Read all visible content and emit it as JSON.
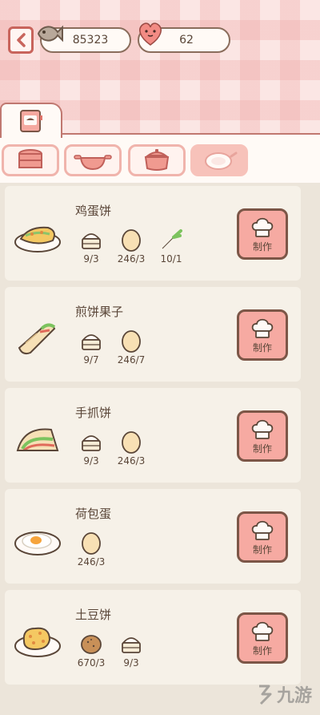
{
  "header": {
    "fish_count": "85323",
    "heart_count": "62"
  },
  "colors": {
    "accent": "#f6aaa2",
    "border": "#7c5647",
    "tab_active": "#f7c2ba"
  },
  "category_tabs": [
    {
      "icon": "steamer-icon",
      "active": false
    },
    {
      "icon": "wok-icon",
      "active": false
    },
    {
      "icon": "pot-icon",
      "active": false
    },
    {
      "icon": "plate-icon",
      "active": true
    }
  ],
  "recipes": [
    {
      "name": "鸡蛋饼",
      "dish_icon": "egg-pancake-icon",
      "ingredients": [
        {
          "icon": "flour-icon",
          "count": "9/3"
        },
        {
          "icon": "egg-icon",
          "count": "246/3"
        },
        {
          "icon": "scallion-icon",
          "count": "10/1"
        }
      ],
      "make_label": "制作"
    },
    {
      "name": "煎饼果子",
      "dish_icon": "jianbing-icon",
      "ingredients": [
        {
          "icon": "flour-icon",
          "count": "9/7"
        },
        {
          "icon": "egg-icon",
          "count": "246/7"
        }
      ],
      "make_label": "制作"
    },
    {
      "name": "手抓饼",
      "dish_icon": "hand-pancake-icon",
      "ingredients": [
        {
          "icon": "flour-icon",
          "count": "9/3"
        },
        {
          "icon": "egg-icon",
          "count": "246/3"
        }
      ],
      "make_label": "制作"
    },
    {
      "name": "荷包蛋",
      "dish_icon": "fried-egg-icon",
      "ingredients": [
        {
          "icon": "egg-icon",
          "count": "246/3"
        }
      ],
      "make_label": "制作"
    },
    {
      "name": "土豆饼",
      "dish_icon": "potato-pancake-icon",
      "ingredients": [
        {
          "icon": "potato-icon",
          "count": "670/3"
        },
        {
          "icon": "flour-icon",
          "count": "9/3"
        }
      ],
      "make_label": "制作"
    }
  ],
  "watermark": "九游"
}
